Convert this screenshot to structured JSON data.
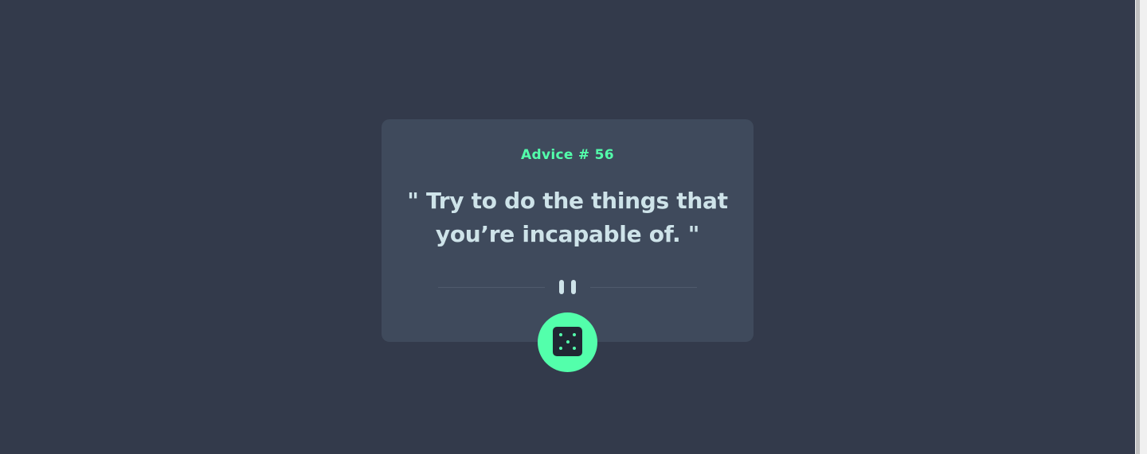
{
  "advice": {
    "title": "Advice # 56",
    "quote": "\" Try to do the things that you’re incapable of. \""
  },
  "icons": {
    "divider": "pause-icon",
    "button": "dice-icon"
  },
  "colors": {
    "background": "#333a4b",
    "card": "#3f4a5c",
    "accent": "#53ffab",
    "text": "#cee3e9",
    "dice_face": "#202733"
  }
}
